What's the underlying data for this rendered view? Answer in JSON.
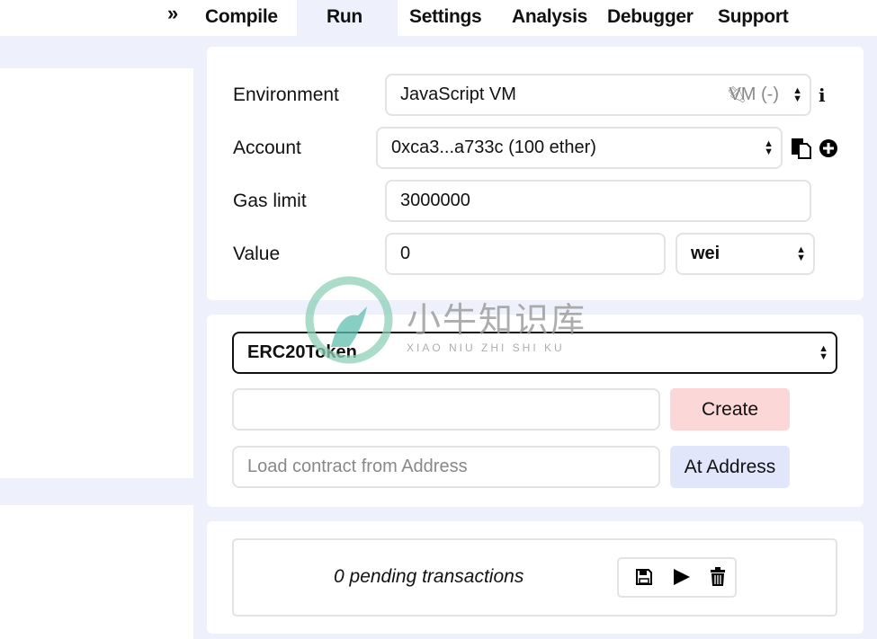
{
  "tabs": [
    {
      "label": "Compile"
    },
    {
      "label": "Run",
      "active": true
    },
    {
      "label": "Settings"
    },
    {
      "label": "Analysis"
    },
    {
      "label": "Debugger"
    },
    {
      "label": "Support"
    }
  ],
  "collapse_icon": "»",
  "settings": {
    "environment_label": "Environment",
    "environment_value": "JavaScript VM",
    "environment_status": "VM (-)",
    "account_label": "Account",
    "account_value": "0xca3...a733c (100 ether)",
    "gas_limit_label": "Gas limit",
    "gas_limit_value": "3000000",
    "value_label": "Value",
    "value_value": "0",
    "value_unit": "wei"
  },
  "contract": {
    "selected": "ERC20Token",
    "create_label": "Create",
    "address_placeholder": "Load contract from Address",
    "at_address_label": "At Address"
  },
  "transactions": {
    "pending_text": "0 pending transactions"
  },
  "watermark": {
    "title": "小牛知识库",
    "subtitle": "XIAO NIU ZHI SHI KU"
  },
  "colors": {
    "background": "#eef0fc",
    "create_button": "#fbd7d7",
    "at_address_button": "#e2e6fa"
  }
}
